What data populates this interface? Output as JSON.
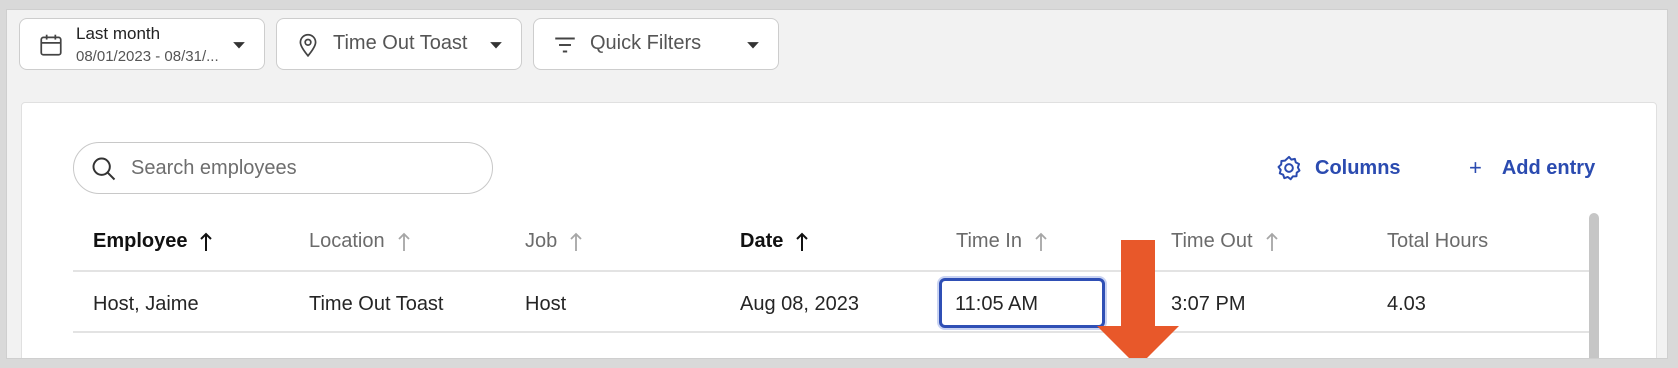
{
  "filters": {
    "date": {
      "label": "Last month",
      "range": "08/01/2023 - 08/31/..."
    },
    "location": {
      "label": "Time Out Toast"
    },
    "quick": {
      "label": "Quick Filters"
    }
  },
  "search": {
    "placeholder": "Search employees"
  },
  "actions": {
    "columns": "Columns",
    "add_entry": "Add entry",
    "add_plus": "+"
  },
  "table": {
    "headers": {
      "employee": "Employee",
      "location": "Location",
      "job": "Job",
      "date": "Date",
      "time_in": "Time In",
      "time_out": "Time Out",
      "total_hours": "Total Hours"
    },
    "rows": [
      {
        "employee": "Host, Jaime",
        "location": "Time Out Toast",
        "job": "Host",
        "date": "Aug 08, 2023",
        "time_in": "11:05 AM",
        "time_out": "3:07 PM",
        "total_hours": "4.03"
      }
    ]
  },
  "colors": {
    "accent": "#2b4bb0",
    "annotation_arrow": "#e8582a"
  }
}
